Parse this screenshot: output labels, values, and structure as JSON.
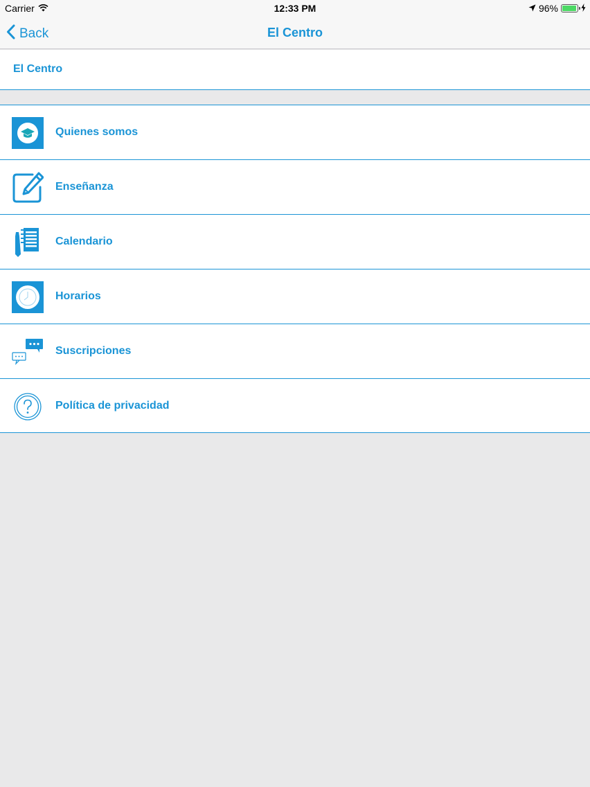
{
  "status_bar": {
    "carrier": "Carrier",
    "time": "12:33 PM",
    "battery": "96%",
    "battery_level": 0.96
  },
  "nav": {
    "back_label": "Back",
    "title": "El Centro"
  },
  "header": {
    "label": "El Centro"
  },
  "menu": {
    "items": [
      {
        "label": "Quienes somos",
        "icon": "graduation-cap-icon"
      },
      {
        "label": "Enseñanza",
        "icon": "pencil-edit-icon"
      },
      {
        "label": "Calendario",
        "icon": "calendar-notebook-icon"
      },
      {
        "label": "Horarios",
        "icon": "clock-icon"
      },
      {
        "label": "Suscripciones",
        "icon": "chat-bubbles-icon"
      },
      {
        "label": "Política de privacidad",
        "icon": "question-circle-icon"
      }
    ]
  },
  "colors": {
    "accent": "#1a94d6",
    "background": "#e9e9ea",
    "battery": "#4cd964"
  }
}
